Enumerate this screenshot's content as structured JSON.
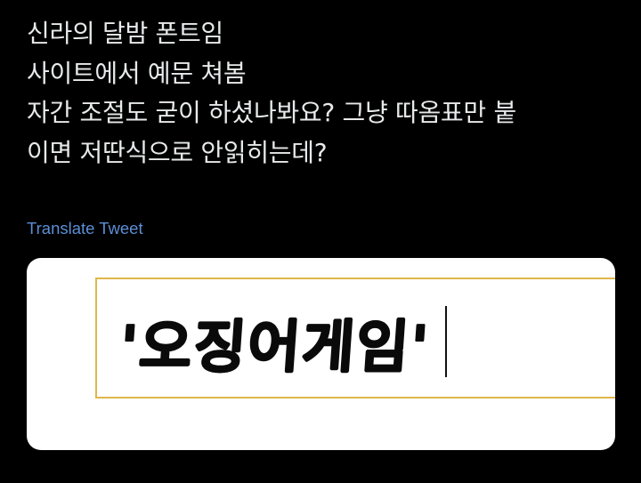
{
  "tweet": {
    "lines": [
      "신라의 달밤 폰트임",
      "사이트에서 예문 쳐봄",
      "자간 조절도 굳이 하셨나봐요? 그냥 따옴표만 붙",
      "이면 저딴식으로 안읽히는데?"
    ],
    "translate_label": "Translate Tweet"
  },
  "media": {
    "sample_text": "'오징어게임'"
  },
  "colors": {
    "background": "#000000",
    "text": "#e7e9ea",
    "link": "#5b8fd6",
    "input_border": "#e0b64a"
  }
}
